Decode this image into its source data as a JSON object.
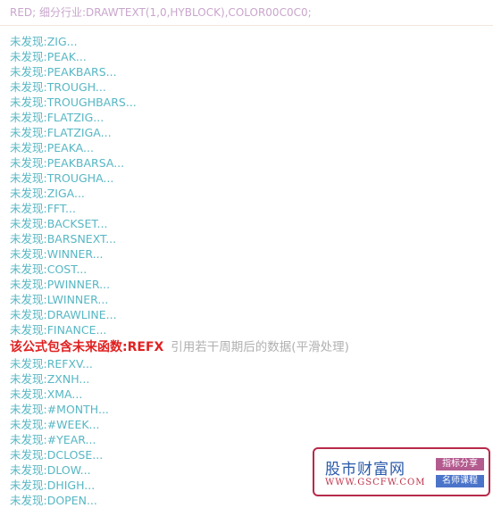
{
  "header": {
    "top_fragment": "“” “” “ ”",
    "code_line": "RED; 细分行业:DRAWTEXT(1,0,HYBLOCK),COLOR00C0C0;"
  },
  "results": {
    "items": [
      "未发现:ZIG...",
      "未发现:PEAK...",
      "未发现:PEAKBARS...",
      "未发现:TROUGH...",
      "未发现:TROUGHBARS...",
      "未发现:FLATZIG...",
      "未发现:FLATZIGA...",
      "未发现:PEAKA...",
      "未发现:PEAKBARSA...",
      "未发现:TROUGHA...",
      "未发现:ZIGA...",
      "未发现:FFT...",
      "未发现:BACKSET...",
      "未发现:BARSNEXT...",
      "未发现:WINNER...",
      "未发现:COST...",
      "未发现:PWINNER...",
      "未发现:LWINNER...",
      "未发现:DRAWLINE...",
      "未发现:FINANCE..."
    ],
    "warning": {
      "label": "该公式包含未来函数:REFX",
      "note": "引用若干周期后的数据(平滑处理)"
    },
    "items_after": [
      "未发现:REFXV...",
      "未发现:ZXNH...",
      "未发现:XMA...",
      "未发现:#MONTH...",
      "未发现:#WEEK...",
      "未发现:#YEAR...",
      "未发现:DCLOSE...",
      "未发现:DLOW...",
      "未发现:DHIGH...",
      "未发现:DOPEN..."
    ]
  },
  "watermark": {
    "site_name": "股市财富网",
    "url": "WWW.GSCFW.COM",
    "tag1": "指标分享",
    "tag2": "名师课程"
  },
  "colors": {
    "item_text": "#57b7c4",
    "warning_text": "#e02020",
    "note_text": "#b0b0b0",
    "code_text": "#c9a6cc"
  }
}
